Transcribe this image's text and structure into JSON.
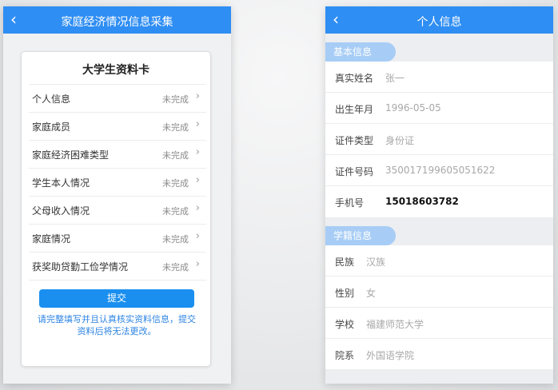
{
  "left_screen": {
    "nav_title": "家庭经济情况信息采集",
    "back_icon": "‹",
    "card_title": "大学生资料卡",
    "rows": [
      {
        "label": "个人信息",
        "status": "未完成"
      },
      {
        "label": "家庭成员",
        "status": "未完成"
      },
      {
        "label": "家庭经济困难类型",
        "status": "未完成"
      },
      {
        "label": "学生本人情况",
        "status": "未完成"
      },
      {
        "label": "父母收入情况",
        "status": "未完成"
      },
      {
        "label": "家庭情况",
        "status": "未完成"
      },
      {
        "label": "获奖助贷勤工俭学情况",
        "status": "未完成"
      }
    ],
    "chevron_icon": "›",
    "submit_label": "提交",
    "notice": "请完整填写并且认真核实资料信息，提交资料后将无法更改。"
  },
  "right_screen": {
    "nav_title": "个人信息",
    "back_icon": "‹",
    "basic_section": "基本信息",
    "basic_fields": [
      {
        "label": "真实姓名",
        "value": "张一"
      },
      {
        "label": "出生年月",
        "value": "1996-05-05"
      },
      {
        "label": "证件类型",
        "value": "身份证"
      },
      {
        "label": "证件号码",
        "value": "350017199605051622"
      },
      {
        "label": "手机号",
        "value": "15018603782"
      }
    ],
    "school_section": "学籍信息",
    "school_fields": [
      {
        "label": "民族",
        "value": "汉族"
      },
      {
        "label": "性别",
        "value": "女"
      },
      {
        "label": "学校",
        "value": "福建师范大学"
      },
      {
        "label": "院系",
        "value": "外国语学院"
      }
    ]
  },
  "colors": {
    "nav_blue": "#2f8ef3",
    "button_blue": "#1a8ff0",
    "section_pill": "#a7cdf6",
    "status_gray": "#8a8a8a"
  }
}
